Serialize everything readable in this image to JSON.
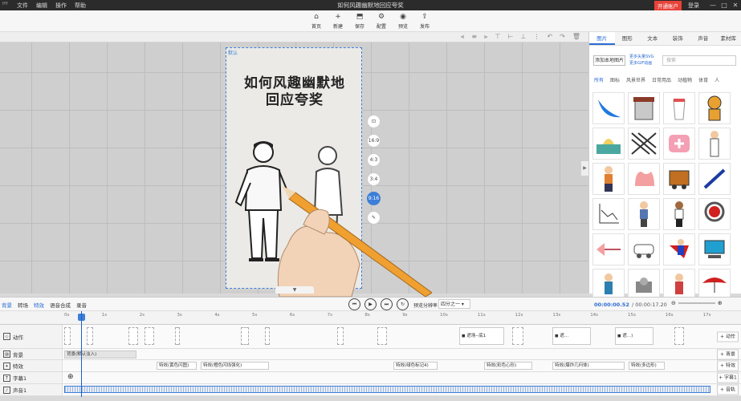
{
  "titlebar": {
    "logo": "HY",
    "menu": [
      "文件",
      "编辑",
      "操作",
      "帮助"
    ],
    "title": "如何风趣幽默地回应夸奖",
    "vip": "开通账户",
    "login": "登录",
    "win": [
      "—",
      "□",
      "✕"
    ]
  },
  "toolbar": [
    {
      "icon": "⌂",
      "label": "首页"
    },
    {
      "icon": "+",
      "label": "新建"
    },
    {
      "icon": "⬒",
      "label": "保存"
    },
    {
      "icon": "⚙",
      "label": "配置"
    },
    {
      "icon": "◉",
      "label": "预览"
    },
    {
      "icon": "⇪",
      "label": "发布"
    }
  ],
  "stage": {
    "tag": "默认",
    "headline_line1": "如何风趣幽默地",
    "headline_line2": "回应夸奖"
  },
  "ratio_tools": [
    "⊡",
    "16:9",
    "4:3",
    "3:4",
    "9:16",
    "✎"
  ],
  "right_panel": {
    "tabs": [
      "图片",
      "图形",
      "文本",
      "装饰",
      "声音",
      "素材库"
    ],
    "upload": "添加本地图片",
    "links": [
      "更多矢量SVG",
      "更多GIF动画"
    ],
    "search_placeholder": "搜索",
    "categories": [
      "所有",
      "图标",
      "风景世界",
      "日常用品",
      "动植物",
      "体育",
      "人"
    ]
  },
  "timeline": {
    "tabs": [
      "背景",
      "转场",
      "特效",
      "语音合成",
      "录音"
    ],
    "ratio_label": "预览分辨率",
    "ratio_value": "四分之一",
    "time_current": "00:00:00.52",
    "time_total": "00:00:17.20",
    "ruler": [
      "0s",
      "1s",
      "2s",
      "3s",
      "4s",
      "5s",
      "6s",
      "7s",
      "8s",
      "9s",
      "10s",
      "11s",
      "12s",
      "13s",
      "14s",
      "15s",
      "16s",
      "17s"
    ],
    "rows": [
      {
        "label": "动作",
        "add": "+ 动作"
      },
      {
        "label": "背景",
        "add": "+ 背景"
      },
      {
        "label": "特效",
        "add": "+ 特效"
      },
      {
        "label": "字幕1",
        "add": "+ 字幕1"
      },
      {
        "label": "声音1",
        "add": "+ 音轨"
      }
    ],
    "bg_clip": "背景(默认淡入)",
    "fx_clips": [
      "特效(黄色闪图)",
      "特效(橙色闪烁强化)",
      "特效(绿色标记4)",
      "特效(彩色心形)",
      "特效(爆炸几何体)",
      "特效(多边形)"
    ],
    "action_clips": [
      "遮场--底1",
      "遮...",
      "遮...)"
    ]
  }
}
